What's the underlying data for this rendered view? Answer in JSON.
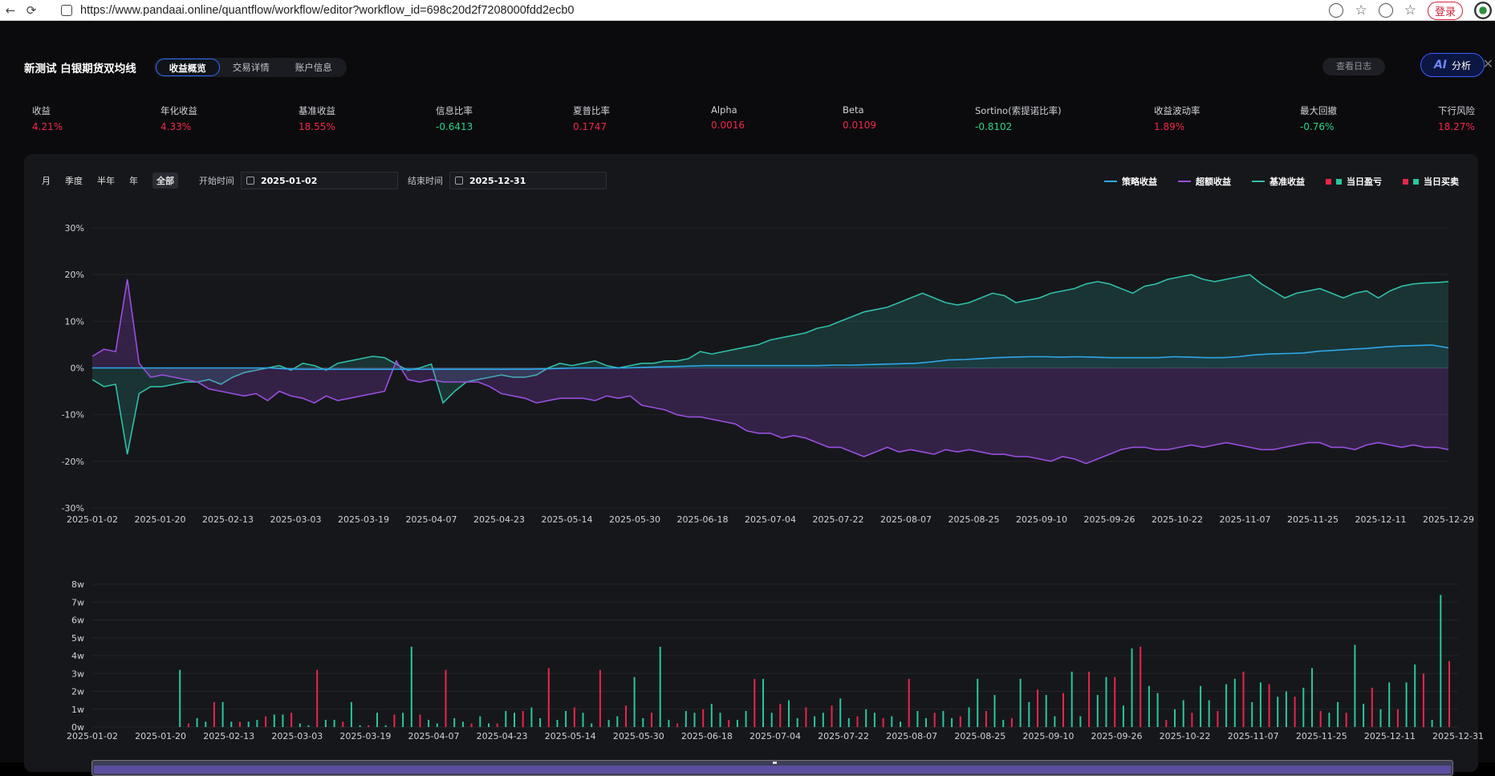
{
  "browser": {
    "url": "https://www.pandaai.online/quantflow/workflow/editor?workflow_id=698c20d2f7208000fdd2ecb0",
    "login_label": "登录"
  },
  "header": {
    "title": "新测试 白银期货双均线",
    "tabs": [
      "收益概览",
      "交易详情",
      "账户信息"
    ],
    "active_tab": 0,
    "log_button": "查看日志",
    "ai_mark": "AI",
    "ai_label": "分析"
  },
  "metrics": [
    {
      "label": "收益",
      "value": "4.21%",
      "tone": "pos"
    },
    {
      "label": "年化收益",
      "value": "4.33%",
      "tone": "pos"
    },
    {
      "label": "基准收益",
      "value": "18.55%",
      "tone": "pos"
    },
    {
      "label": "信息比率",
      "value": "-0.6413",
      "tone": "neg"
    },
    {
      "label": "夏普比率",
      "value": "0.1747",
      "tone": "pos"
    },
    {
      "label": "Alpha",
      "value": "0.0016",
      "tone": "pos"
    },
    {
      "label": "Beta",
      "value": "0.0109",
      "tone": "pos"
    },
    {
      "label": "Sortino(索提诺比率)",
      "value": "-0.8102",
      "tone": "neg"
    },
    {
      "label": "收益波动率",
      "value": "1.89%",
      "tone": "pos"
    },
    {
      "label": "最大回撤",
      "value": "-0.76%",
      "tone": "neg"
    },
    {
      "label": "下行风险",
      "value": "18.27%",
      "tone": "pos"
    }
  ],
  "filters": {
    "periods": [
      "月",
      "季度",
      "半年",
      "年",
      "全部"
    ],
    "active_period": 4,
    "start_label": "开始时间",
    "start_value": "2025-01-02",
    "end_label": "结束时间",
    "end_value": "2025-12-31"
  },
  "legend": [
    {
      "label": "策略收益",
      "kind": "line",
      "color": "#2ea7e8"
    },
    {
      "label": "超额收益",
      "kind": "line",
      "color": "#9a4fe0"
    },
    {
      "label": "基准收益",
      "kind": "line",
      "color": "#2fbfa8"
    },
    {
      "label": "当日盈亏",
      "kind": "squares",
      "colors": [
        "#e8264a",
        "#29c79c"
      ]
    },
    {
      "label": "当日买卖",
      "kind": "squares",
      "colors": [
        "#e8264a",
        "#29c79c"
      ]
    }
  ],
  "colors": {
    "strategy": "#2ea7e8",
    "excess": "#9a4fe0",
    "benchmark": "#2fbfa8",
    "bar_red": "#e8264a",
    "bar_green": "#29c79c"
  },
  "chart_data": [
    {
      "type": "line",
      "title": "",
      "x_ticks": [
        "2025-01-02",
        "2025-01-20",
        "2025-02-13",
        "2025-03-03",
        "2025-03-19",
        "2025-04-07",
        "2025-04-23",
        "2025-05-14",
        "2025-05-30",
        "2025-06-18",
        "2025-07-04",
        "2025-07-22",
        "2025-08-07",
        "2025-08-25",
        "2025-09-10",
        "2025-09-26",
        "2025-10-22",
        "2025-11-07",
        "2025-11-25",
        "2025-12-11",
        "2025-12-29"
      ],
      "y_ticks": [
        "30%",
        "20%",
        "10%",
        "0%",
        "-10%",
        "-20%",
        "-30%"
      ],
      "ylim": [
        -30,
        30
      ],
      "grid": true,
      "series": [
        {
          "name": "策略收益",
          "values": [
            0,
            0,
            0,
            0,
            0,
            0,
            0,
            0,
            0,
            0,
            0,
            0,
            -0.2,
            -0.3,
            -0.3,
            -0.3,
            -0.3,
            -0.3,
            -0.3,
            -0.3,
            -0.3,
            -0.3,
            -0.3,
            -0.3,
            -0.3,
            -0.3,
            -0.3,
            -0.3,
            -0.2,
            -0.1,
            0,
            0,
            0,
            0,
            0.1,
            0.2,
            0.3,
            0.4,
            0.5,
            0.5,
            0.5,
            0.5,
            0.5,
            0.5,
            0.5,
            0.5,
            0.6,
            0.6,
            0.7,
            0.8,
            0.9,
            1.0,
            1.3,
            1.7,
            1.8,
            2.0,
            2.2,
            2.3,
            2.4,
            2.4,
            2.3,
            2.4,
            2.3,
            2.2,
            2.2,
            2.2,
            2.2,
            2.4,
            2.3,
            2.2,
            2.2,
            2.4,
            2.8,
            3.0,
            3.1,
            3.2,
            3.6,
            3.8,
            4.0,
            4.2,
            4.5,
            4.7,
            4.8,
            4.9,
            4.3
          ]
        },
        {
          "name": "超额收益",
          "values": [
            2.5,
            4,
            3.5,
            19,
            1,
            -2,
            -1.5,
            -2,
            -2.5,
            -3,
            -4.5,
            -5,
            -5.5,
            -6,
            -5.5,
            -7,
            -5,
            -6,
            -6.5,
            -7.5,
            -6,
            -7,
            -6.5,
            -6,
            -5.5,
            -5,
            1.5,
            -2.5,
            -3,
            -2.5,
            -3,
            -3,
            -3,
            -3,
            -4,
            -5.5,
            -6,
            -6.5,
            -7.5,
            -7,
            -6.5,
            -6.5,
            -6.5,
            -7,
            -6,
            -6.5,
            -6,
            -8,
            -8.5,
            -9,
            -10,
            -10.5,
            -10.5,
            -11,
            -11.5,
            -12,
            -13.5,
            -14,
            -14,
            -15,
            -14.5,
            -15,
            -16,
            -17,
            -17,
            -18,
            -19,
            -18,
            -17,
            -18,
            -17.5,
            -18,
            -18.5,
            -17.5,
            -18,
            -17.5,
            -18,
            -18.5,
            -18.5,
            -19,
            -19,
            -19.5,
            -20,
            -19,
            -19.5,
            -20.5,
            -19.5,
            -18.5,
            -17.5,
            -17,
            -17,
            -17.5,
            -17.5,
            -17,
            -16.5,
            -17,
            -16.5,
            -16,
            -16.5,
            -17,
            -17.5,
            -17.5,
            -17,
            -16.5,
            -16,
            -16,
            -17,
            -17,
            -17.5,
            -16.5,
            -16,
            -16.5,
            -17,
            -16.5,
            -17,
            -17,
            -17.5
          ]
        },
        {
          "name": "基准收益",
          "values": [
            -2.5,
            -4,
            -3.5,
            -18.5,
            -5.5,
            -4,
            -4,
            -3.5,
            -3,
            -3,
            -2.5,
            -3.5,
            -2,
            -1,
            -0.5,
            0,
            0.5,
            -0.5,
            1,
            0.5,
            -0.5,
            1,
            1.5,
            2,
            2.5,
            2.2,
            0.8,
            -0.5,
            0,
            0.8,
            -7.5,
            -5,
            -3,
            -2.5,
            -2,
            -1.5,
            -2,
            -2,
            -1.5,
            0,
            1,
            0.5,
            1,
            1.5,
            0.5,
            0,
            0.5,
            1,
            1,
            1.5,
            1.5,
            2,
            3.5,
            3,
            3.5,
            4,
            4.5,
            5,
            6,
            6.5,
            7,
            7.5,
            8.5,
            9,
            10,
            11,
            12,
            12.5,
            13,
            14,
            15,
            16,
            15,
            14,
            13.5,
            14,
            15,
            16,
            15.5,
            14,
            14.5,
            15,
            16,
            16.5,
            17,
            18,
            18.5,
            18,
            17,
            16,
            17.5,
            18,
            19,
            19.5,
            20,
            19,
            18.5,
            19,
            19.5,
            20,
            18,
            16.5,
            15,
            16,
            16.5,
            17,
            16,
            15,
            16,
            16.5,
            15,
            16.5,
            17.5,
            18,
            18.2,
            18.3,
            18.5
          ]
        }
      ]
    },
    {
      "type": "bar",
      "title": "",
      "x_ticks": [
        "2025-01-02",
        "2025-01-20",
        "2025-02-13",
        "2025-03-03",
        "2025-03-19",
        "2025-04-07",
        "2025-04-23",
        "2025-05-14",
        "2025-05-30",
        "2025-06-18",
        "2025-07-04",
        "2025-07-22",
        "2025-08-07",
        "2025-08-25",
        "2025-09-10",
        "2025-09-26",
        "2025-10-22",
        "2025-11-07",
        "2025-11-25",
        "2025-12-11",
        "2025-12-31"
      ],
      "y_ticks": [
        "8w",
        "7w",
        "6w",
        "5w",
        "4w",
        "3w",
        "2w",
        "1w",
        "0w"
      ],
      "ylim": [
        0,
        8
      ],
      "grid": true,
      "series": [
        {
          "name": "当日盈亏",
          "values": [
            0,
            0,
            0,
            0,
            0,
            0,
            0,
            0,
            0,
            3.2,
            0.2,
            0.5,
            0.3,
            1.4,
            1.4,
            0.3,
            0.3,
            0.3,
            0.4,
            0.6,
            0.7,
            0.7,
            0.8,
            0.2,
            0.1,
            3.2,
            0.4,
            0.4,
            0.3,
            1.4,
            0.1,
            0.1,
            0.8,
            0.1,
            0.7,
            0.8,
            4.5,
            0.7,
            0.4,
            0.2,
            3.2,
            0.5,
            0.3,
            0.2,
            0.6,
            0.2,
            0.2,
            0.9,
            0.8,
            0.9,
            1.1,
            0.5,
            3.3,
            0.4,
            0.9,
            1.1,
            0.8,
            0.2,
            3.2,
            0.4,
            0.6,
            1.2,
            2.8,
            0.5,
            0.8,
            4.5,
            0.4,
            0.2,
            0.9,
            0.8,
            1.0,
            1.3,
            0.8,
            0.4,
            0.4,
            0.9,
            2.7,
            2.7,
            0.8,
            1.3,
            1.5,
            0.5,
            1.1,
            0.6,
            0.8,
            1.2,
            1.6,
            0.5,
            0.6,
            1.0,
            0.8,
            0.5,
            0.6,
            0.3,
            2.7,
            0.9,
            0.5,
            0.8,
            0.9,
            0.5,
            0.6,
            1.1,
            2.7,
            0.9,
            1.8,
            0.4,
            0.5,
            2.7,
            1.4,
            2.1,
            1.8,
            0.6,
            1.9,
            3.1,
            0.6,
            3.1,
            1.8,
            2.8,
            2.8,
            1.2,
            4.4,
            4.5,
            2.3,
            1.9,
            0.4,
            1.0,
            1.5,
            0.8,
            2.3,
            1.5,
            0.9,
            2.4,
            2.7,
            3.1,
            1.4,
            2.5,
            2.4,
            1.7,
            2.0,
            1.7,
            2.2,
            3.3,
            0.9,
            0.8,
            1.4,
            0.8,
            4.6,
            1.3,
            2.2,
            1.0,
            2.5,
            1.0,
            2.5,
            3.5,
            3.0,
            0.4,
            7.4,
            3.7
          ]
        }
      ]
    }
  ]
}
